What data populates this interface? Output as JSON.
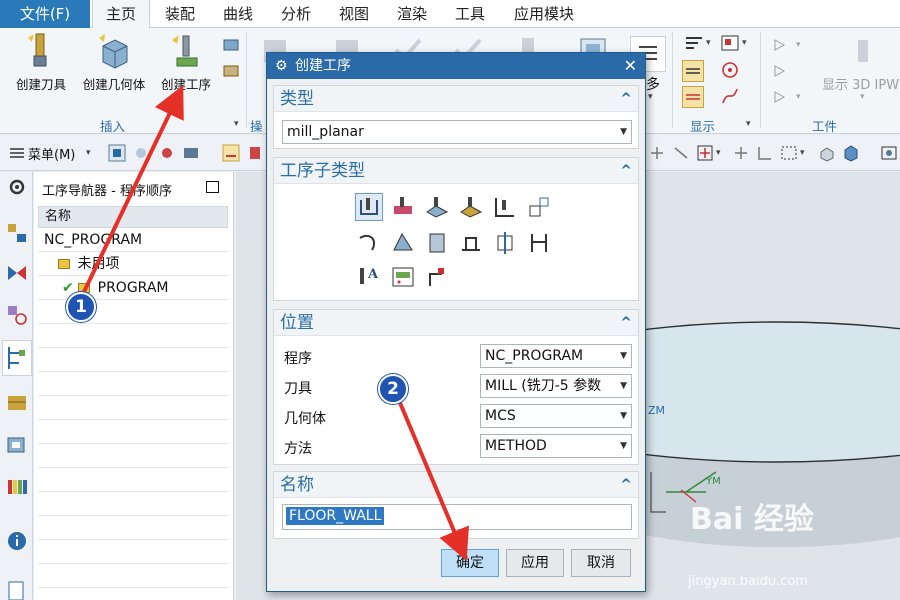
{
  "menu": {
    "file": "文件(F)",
    "tabs": [
      "主页",
      "装配",
      "曲线",
      "分析",
      "视图",
      "渲染",
      "工具",
      "应用模块"
    ],
    "active": "主页"
  },
  "ribbon": {
    "create_tool": "创建刀具",
    "create_geometry": "创建几何体",
    "create_operation": "创建工序",
    "group_insert": "插入",
    "group_ops_partial": "操",
    "more_partial": "多",
    "group_display": "显示",
    "group_tools": "工件",
    "show_3d_ipw": "显示 3D IPW"
  },
  "toolbar2": {
    "menu": "菜单(M)"
  },
  "navigator": {
    "title": "工序导航器 - 程序顺序",
    "column_name": "名称",
    "rows": [
      "NC_PROGRAM",
      "未用项",
      "PROGRAM"
    ]
  },
  "dialog": {
    "title": "创建工序",
    "type_section": "类型",
    "type_value": "mill_planar",
    "subtype_section": "工序子类型",
    "location_section": "位置",
    "fields": [
      {
        "label": "程序",
        "value": "NC_PROGRAM"
      },
      {
        "label": "刀具",
        "value": "MILL (铣刀-5 参数"
      },
      {
        "label": "几何体",
        "value": "MCS"
      },
      {
        "label": "方法",
        "value": "METHOD"
      }
    ],
    "name_section": "名称",
    "name_value": "FLOOR_WALL",
    "ok": "确定",
    "apply": "应用",
    "cancel": "取消"
  },
  "viewport": {
    "zm_label": "ZM",
    "ym_label": "YM"
  },
  "annotations": {
    "step1": "1",
    "step2": "2"
  },
  "watermark": {
    "brand": "Bai 经验",
    "url": "jingyan.baidu.com"
  },
  "colors": {
    "accent": "#2a6aa8",
    "file_menu": "#2a7ab9",
    "arrow": "#e53028",
    "badge": "#1f54b3",
    "cylinder": "#d6e6ec"
  }
}
